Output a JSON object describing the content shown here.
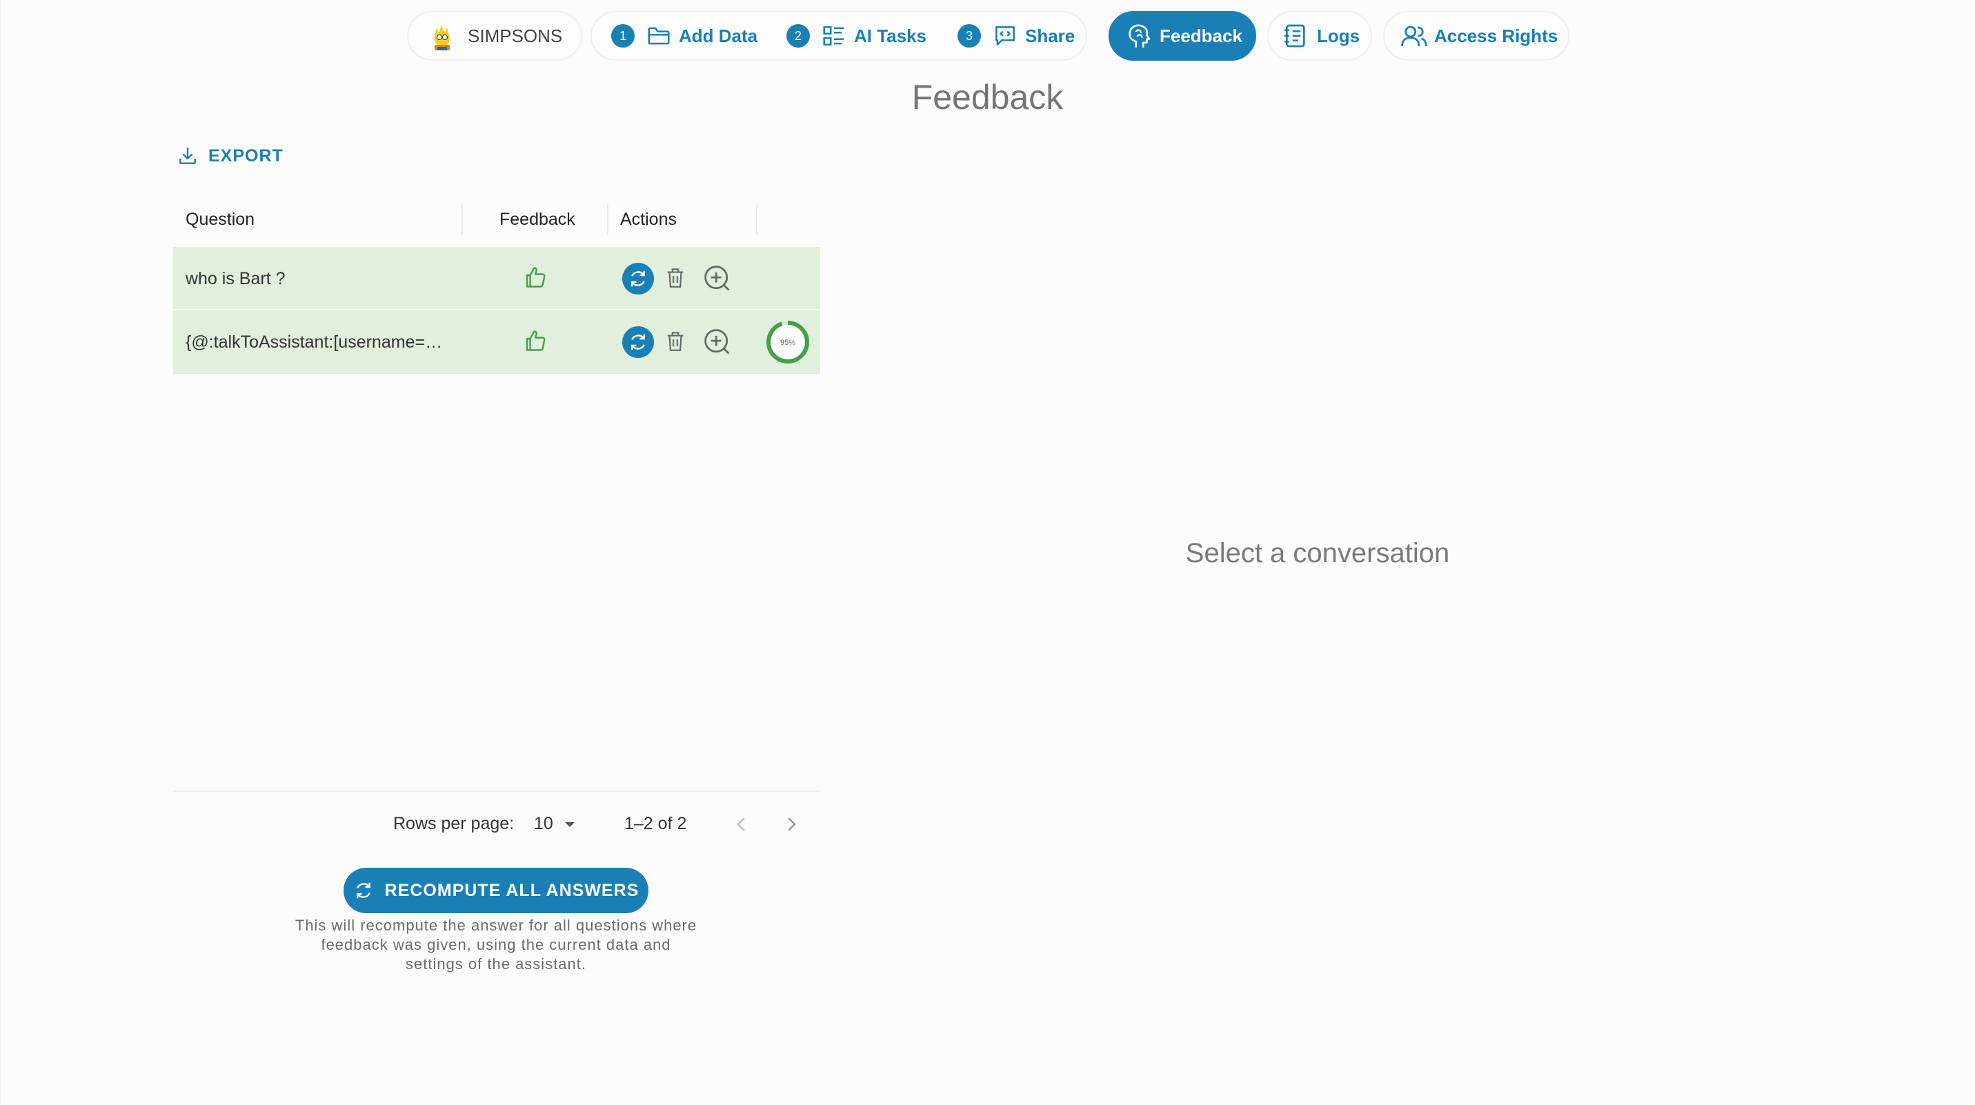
{
  "nav": {
    "assistant_name": "SIMPSONS",
    "steps": [
      {
        "number": "1",
        "label": "Add Data",
        "icon": "folder-icon"
      },
      {
        "number": "2",
        "label": "AI Tasks",
        "icon": "tasks-icon"
      },
      {
        "number": "3",
        "label": "Share",
        "icon": "share-icon"
      }
    ],
    "feedback_label": "Feedback",
    "logs_label": "Logs",
    "access_rights_label": "Access Rights"
  },
  "page_title": "Feedback",
  "table": {
    "export_label": "EXPORT",
    "columns": [
      "Question",
      "Feedback",
      "Actions"
    ],
    "rows": [
      {
        "question": "who is Bart ?",
        "feedback": "thumbs-up-icon",
        "progress": null
      },
      {
        "question": "{@:talkToAssistant:[username=…",
        "feedback": "thumbs-up-icon",
        "progress": "95%"
      }
    ],
    "pagination": {
      "rows_per_page_label": "Rows per page:",
      "rows_per_page_value": "10",
      "range": "1–2 of 2"
    }
  },
  "recompute": {
    "button_label": "RECOMPUTE ALL ANSWERS",
    "note_line1": "This will recompute the answer for all questions where",
    "note_line2": "feedback was given, using the current data and",
    "note_line3": "settings of the assistant."
  },
  "detail": {
    "empty_text": "Select a conversation"
  },
  "colors": {
    "accent": "#1a7fb5",
    "row_highlight": "#e2efdd",
    "success": "#43a047"
  }
}
